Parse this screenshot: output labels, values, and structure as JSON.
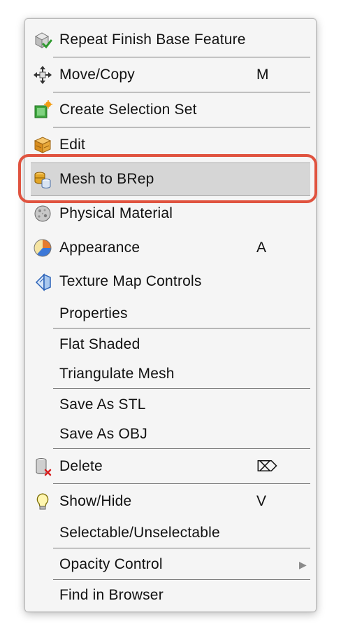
{
  "colors": {
    "menu_background": "#f5f5f5",
    "highlight_background": "#d6d6d6",
    "callout_outline": "#e0533f",
    "separator": "#7a7a7a"
  },
  "menu": {
    "items": [
      {
        "label": "Repeat Finish Base Feature",
        "shortcut": "",
        "icon": "finish-base-feature-icon"
      },
      {
        "label": "Move/Copy",
        "shortcut": "M",
        "icon": "move-arrows-icon"
      },
      {
        "label": "Create Selection Set",
        "shortcut": "",
        "icon": "selection-set-icon"
      },
      {
        "label": "Edit",
        "shortcut": "",
        "icon": "edit-box-icon"
      },
      {
        "label": "Mesh to BRep",
        "shortcut": "",
        "icon": "mesh-to-brep-icon",
        "highlighted": true
      },
      {
        "label": "Physical Material",
        "shortcut": "",
        "icon": "physical-material-icon"
      },
      {
        "label": "Appearance",
        "shortcut": "A",
        "icon": "appearance-icon"
      },
      {
        "label": "Texture Map Controls",
        "shortcut": "",
        "icon": "texture-map-icon"
      },
      {
        "label": "Properties",
        "shortcut": ""
      },
      {
        "label": "Flat Shaded",
        "shortcut": ""
      },
      {
        "label": "Triangulate Mesh",
        "shortcut": ""
      },
      {
        "label": "Save As STL",
        "shortcut": ""
      },
      {
        "label": "Save As OBJ",
        "shortcut": ""
      },
      {
        "label": "Delete",
        "shortcut": "⌦",
        "icon": "delete-trash-icon"
      },
      {
        "label": "Show/Hide",
        "shortcut": "V",
        "icon": "lightbulb-icon"
      },
      {
        "label": "Selectable/Unselectable",
        "shortcut": ""
      },
      {
        "label": "Opacity Control",
        "shortcut": "",
        "submenu_arrow": "▶"
      },
      {
        "label": "Find in Browser",
        "shortcut": ""
      }
    ]
  }
}
